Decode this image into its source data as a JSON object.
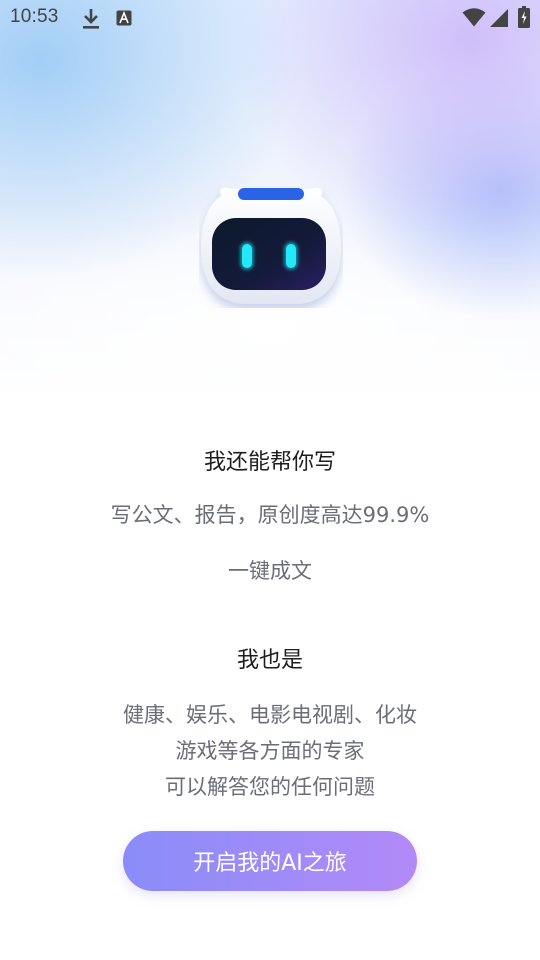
{
  "status_bar": {
    "time": "10:53",
    "icons": [
      "download-icon",
      "a-letter-icon",
      "wifi-icon",
      "signal-icon",
      "battery-charging-icon"
    ]
  },
  "mascot": {
    "icon": "robot-mascot-icon"
  },
  "section1": {
    "title": "我还能帮你写",
    "line1": "写公文、报告，原创度高达99.9%",
    "line2": "一键成文"
  },
  "section2": {
    "title": "我也是",
    "line1": "健康、娱乐、电影电视剧、化妆",
    "line2": "游戏等各方面的专家",
    "line3": "可以解答您的任何问题"
  },
  "cta": {
    "label": "开启我的AI之旅"
  },
  "colors": {
    "button_gradient_start": "#8a8cf9",
    "button_gradient_end": "#b28af7",
    "robot_eye": "#1fe6f5",
    "robot_accent": "#2b63e6"
  }
}
